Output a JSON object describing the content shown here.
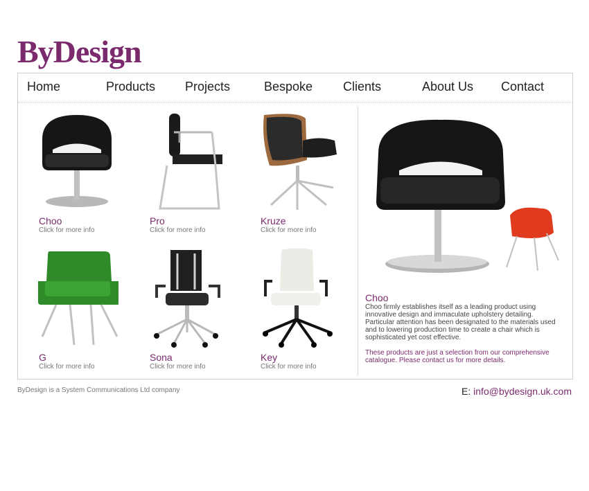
{
  "brand": {
    "logo_text": "ByDesign"
  },
  "nav": {
    "items": [
      {
        "label": "Home"
      },
      {
        "label": "Products"
      },
      {
        "label": "Projects"
      },
      {
        "label": "Bespoke"
      },
      {
        "label": "Clients"
      },
      {
        "label": "About Us"
      },
      {
        "label": "Contact"
      }
    ]
  },
  "products": [
    {
      "name": "Choo",
      "info": "Click for more info"
    },
    {
      "name": "Pro",
      "info": "Click for more info"
    },
    {
      "name": "Kruze",
      "info": "Click for more info"
    },
    {
      "name": "G",
      "info": "Click for more info"
    },
    {
      "name": "Sona",
      "info": "Click for more info"
    },
    {
      "name": "Key",
      "info": "Click for more info"
    }
  ],
  "detail": {
    "title": "Choo",
    "description": "Choo firmly establishes itself as a leading product using innovative design and immaculate upholstery detailing. Particular attention has been designated to the materials used and to lowering production time to create a chair which is sophisticated yet cost effective.",
    "note": "These products are just a selection from our comprehensive catalogue. Please contact us for more details."
  },
  "footer": {
    "company": "ByDesign is a System Communications Ltd company",
    "email_label": "E:",
    "email": "info@bydesign.uk.com"
  },
  "colors": {
    "brand": "#7b2a6e",
    "border": "#cfcfcf"
  }
}
